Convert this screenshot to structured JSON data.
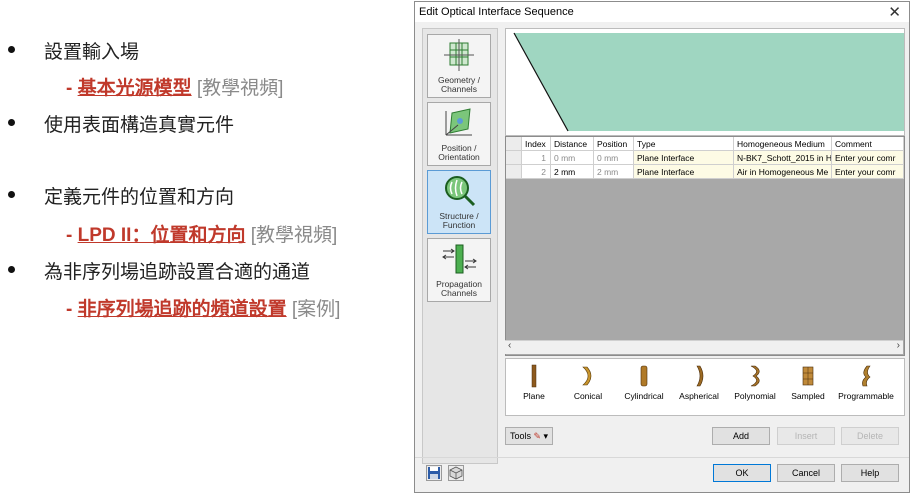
{
  "slide": {
    "bullets": [
      {
        "text": "設置輸入場"
      },
      {
        "text": "使用表面構造真實元件"
      },
      {
        "text": "定義元件的位置和方向"
      },
      {
        "text": "為非序列場追跡設置合適的通道"
      }
    ],
    "subs": [
      {
        "dash": "-",
        "link": "基本光源模型",
        "tag": "[教學視頻]"
      },
      {
        "dash": "-",
        "link": "LPD II：位置和方向",
        "tag": "[教學視頻]"
      },
      {
        "dash": "-",
        "link": "非序列場追跡的頻道設置",
        "tag": "[案例]"
      }
    ]
  },
  "dialog": {
    "title": "Edit Optical Interface Sequence",
    "close_glyph": "✕",
    "nav": [
      {
        "line1": "Geometry /",
        "line2": "Channels"
      },
      {
        "line1": "Position /",
        "line2": "Orientation"
      },
      {
        "line1": "Structure /",
        "line2": "Function"
      },
      {
        "line1": "Propagation",
        "line2": "Channels"
      }
    ],
    "table": {
      "columns": [
        "Index",
        "Distance",
        "Position",
        "Type",
        "Homogeneous Medium",
        "Comment"
      ],
      "rows": [
        {
          "index": "1",
          "distance": "0 mm",
          "position": "0 mm",
          "type": "Plane Interface",
          "medium": "N-BK7_Schott_2015 in H",
          "comment": "Enter your comr"
        },
        {
          "index": "2",
          "distance": "2 mm",
          "position": "2 mm",
          "type": "Plane Interface",
          "medium": "Air in Homogeneous Me",
          "comment": "Enter your comr"
        }
      ]
    },
    "scroll": {
      "left": "‹",
      "right": "›"
    },
    "palette": [
      "Plane",
      "Conical",
      "Cylindrical",
      "Aspherical",
      "Polynomial",
      "Sampled",
      "Programmable"
    ],
    "buttons": {
      "tools": "Tools",
      "add": "Add",
      "insert": "Insert",
      "delete": "Delete",
      "ok": "OK",
      "cancel": "Cancel",
      "help": "Help"
    },
    "colors": {
      "preview_fill": "#9fd6c1",
      "accent": "#c0392b",
      "active_nav": "#cce4f7"
    }
  }
}
